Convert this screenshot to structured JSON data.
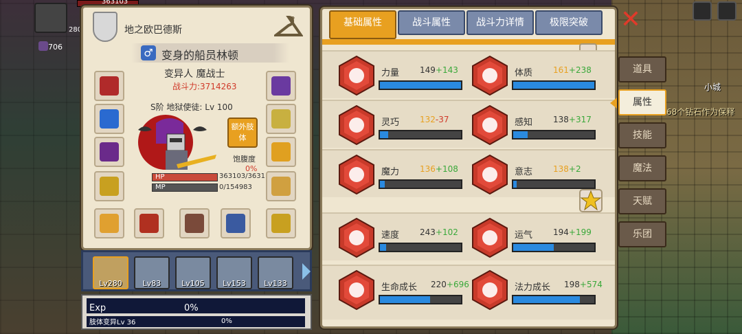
{
  "hud": {
    "hp_value": "363103",
    "hp_label": "HP",
    "mp_short": "280",
    "level_value": "706"
  },
  "character": {
    "faction_name": "地之欧巴德斯",
    "name": "变身的船员林顿",
    "class": "变异人 魔战士",
    "power": "战斗力:3714263",
    "rank": "S阶 地狱使徒: Lv 100",
    "extra_body": "额外肢体",
    "satiety_label": "饱腹度",
    "satiety_value": "0%",
    "hp_label": "HP",
    "hp_text": "363103/3631",
    "mp_label": "MP",
    "mp_text": "0/154983",
    "hp_fraction": 1.0,
    "mp_fraction": 0.0,
    "equip_colors": [
      "#b02a2a",
      "#2a6ad0",
      "#6a2a8a",
      "#c8a020",
      "#e0a030",
      "#b03020",
      "#7a4a3a",
      "#3a5aa0",
      "#c8a020",
      "#d0a040",
      "#e0a020",
      "#c8b040",
      "#6a3aa0",
      "#c05010"
    ]
  },
  "party": [
    {
      "level": "Lv280",
      "active": true
    },
    {
      "level": "Lv83",
      "active": false
    },
    {
      "level": "Lv105",
      "active": false
    },
    {
      "level": "Lv153",
      "active": false
    },
    {
      "level": "Lv133",
      "active": false
    }
  ],
  "exp": {
    "label": "Exp",
    "value": "0%",
    "mutation_label": "肢体变异Lv 36",
    "mutation_value": "0%"
  },
  "tabs": [
    "基础属性",
    "战斗属性",
    "战斗力详情",
    "极限突破"
  ],
  "active_tab": 0,
  "attributes": [
    {
      "name": "力量",
      "base": "149",
      "bonus": "+143",
      "fill": 1.0,
      "icon": "muscle-arm-icon",
      "base_color": "#333333"
    },
    {
      "name": "体质",
      "base": "161",
      "bonus": "+238",
      "fill": 1.0,
      "icon": "strongman-icon",
      "base_color": "#e8a020"
    },
    {
      "name": "灵巧",
      "base": "132",
      "bonus": "-37",
      "fill": 0.1,
      "icon": "running-man-icon",
      "base_color": "#e8a020",
      "bonus_color": "#d03a2a"
    },
    {
      "name": "感知",
      "base": "138",
      "bonus": "+317",
      "fill": 0.18,
      "icon": "eye-icon",
      "base_color": "#333333"
    },
    {
      "name": "魔力",
      "base": "136",
      "bonus": "+108",
      "fill": 0.06,
      "icon": "spiral-icon",
      "base_color": "#e8a020"
    },
    {
      "name": "意志",
      "base": "138",
      "bonus": "+2",
      "fill": 0.04,
      "icon": "lightning-head-icon",
      "base_color": "#e8a020"
    },
    {
      "name": "速度",
      "base": "243",
      "bonus": "+102",
      "fill": 0.08,
      "icon": "wing-icon",
      "base_color": "#333333"
    },
    {
      "name": "运气",
      "base": "194",
      "bonus": "+199",
      "fill": 0.5,
      "icon": "clover-icon",
      "base_color": "#333333"
    },
    {
      "name": "生命成长",
      "base": "220",
      "bonus": "+696",
      "fill": 0.62,
      "icon": "heart-icon",
      "base_color": "#333333"
    },
    {
      "name": "法力成长",
      "base": "198",
      "bonus": "+574",
      "fill": 0.82,
      "icon": "mana-figure-icon",
      "base_color": "#333333"
    }
  ],
  "side_tabs": [
    "道具",
    "属性",
    "技能",
    "魔法",
    "天赋",
    "乐团"
  ],
  "active_side_tab": 1,
  "scene": {
    "city_label": "小城",
    "scroll_text": "68个钻石作为保释"
  },
  "colors": {
    "accent": "#e8a020",
    "bar_blue": "#2a8ae0",
    "panel": "#efe6d0",
    "bonus_green": "#3aa83a",
    "red": "#d03a2a"
  }
}
